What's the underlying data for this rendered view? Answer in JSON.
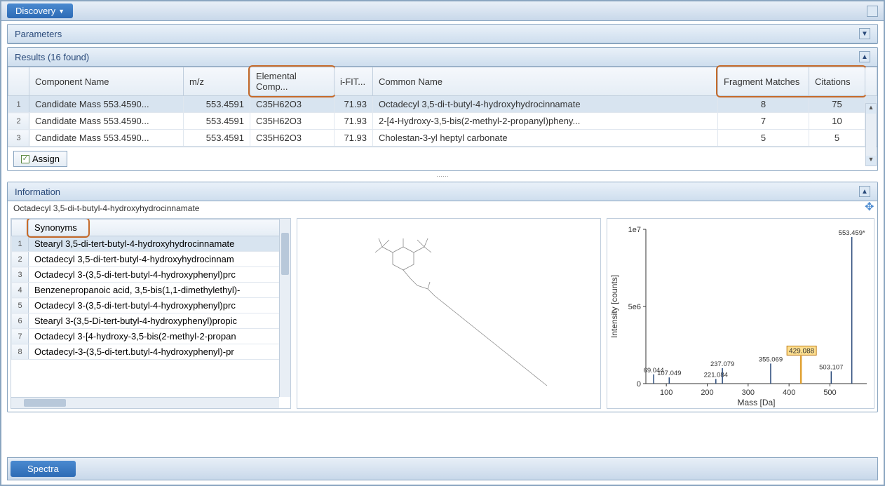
{
  "toolbar": {
    "discovery": "Discovery"
  },
  "parameters": {
    "title": "Parameters"
  },
  "results": {
    "title": "Results (16 found)",
    "columns": {
      "component": "Component Name",
      "mz": "m/z",
      "elemental": "Elemental Comp...",
      "ifit": "i-FIT...",
      "common": "Common Name",
      "fragment": "Fragment Matches",
      "citations": "Citations"
    },
    "rows": [
      {
        "n": "1",
        "component": "Candidate Mass 553.4590...",
        "mz": "553.4591",
        "elemental": "C35H62O3",
        "ifit": "71.93",
        "common": "Octadecyl 3,5-di-t-butyl-4-hydroxyhydrocinnamate",
        "fragment": "8",
        "citations": "75"
      },
      {
        "n": "2",
        "component": "Candidate Mass 553.4590...",
        "mz": "553.4591",
        "elemental": "C35H62O3",
        "ifit": "71.93",
        "common": "2-[4-Hydroxy-3,5-bis(2-methyl-2-propanyl)pheny...",
        "fragment": "7",
        "citations": "10"
      },
      {
        "n": "3",
        "component": "Candidate Mass 553.4590...",
        "mz": "553.4591",
        "elemental": "C35H62O3",
        "ifit": "71.93",
        "common": "Cholestan-3-yl heptyl carbonate",
        "fragment": "5",
        "citations": "5"
      }
    ],
    "assign": "Assign"
  },
  "information": {
    "title": "Information",
    "compound": "Octadecyl 3,5-di-t-butyl-4-hydroxyhydrocinnamate",
    "synonyms_header": "Synonyms",
    "synonyms": [
      "Stearyl 3,5-di-tert-butyl-4-hydroxyhydrocinnamate",
      "Octadecyl 3,5-di-tert-butyl-4-hydroxyhydrocinnam",
      "Octadecyl 3-(3,5-di-tert-butyl-4-hydroxyphenyl)prc",
      "Benzenepropanoic acid, 3,5-bis(1,1-dimethylethyl)-",
      "Octadecyl 3-(3,5-di-tert-butyl-4-hydroxyphenyl)prc",
      "Stearyl 3-(3,5-Di-tert-butyl-4-hydroxyphenyl)propic",
      "Octadecyl 3-[4-hydroxy-3,5-bis(2-methyl-2-propan",
      "Octadecyl-3-(3,5-di-tert.butyl-4-hydroxyphenyl)-pr"
    ]
  },
  "chart_data": {
    "type": "bar",
    "title": "",
    "xlabel": "Mass [Da]",
    "ylabel": "Intensity [counts]",
    "ylim": [
      0,
      10000000.0
    ],
    "yticks": [
      "0",
      "5e6",
      "1e7"
    ],
    "xticks": [
      "100",
      "200",
      "300",
      "400",
      "500"
    ],
    "peaks": [
      {
        "mass": 69.044,
        "intensity": 600000.0,
        "label": "69.044"
      },
      {
        "mass": 107.049,
        "intensity": 400000.0,
        "label": "107.049"
      },
      {
        "mass": 221.084,
        "intensity": 300000.0,
        "label": "221.084"
      },
      {
        "mass": 237.079,
        "intensity": 1000000.0,
        "label": "237.079"
      },
      {
        "mass": 355.069,
        "intensity": 1300000.0,
        "label": "355.069"
      },
      {
        "mass": 429.088,
        "intensity": 1800000.0,
        "label": "429.088",
        "highlight": true
      },
      {
        "mass": 503.107,
        "intensity": 800000.0,
        "label": "503.107"
      },
      {
        "mass": 553.459,
        "intensity": 9500000.0,
        "label": "553.459*"
      }
    ]
  },
  "footer": {
    "spectra": "Spectra"
  }
}
